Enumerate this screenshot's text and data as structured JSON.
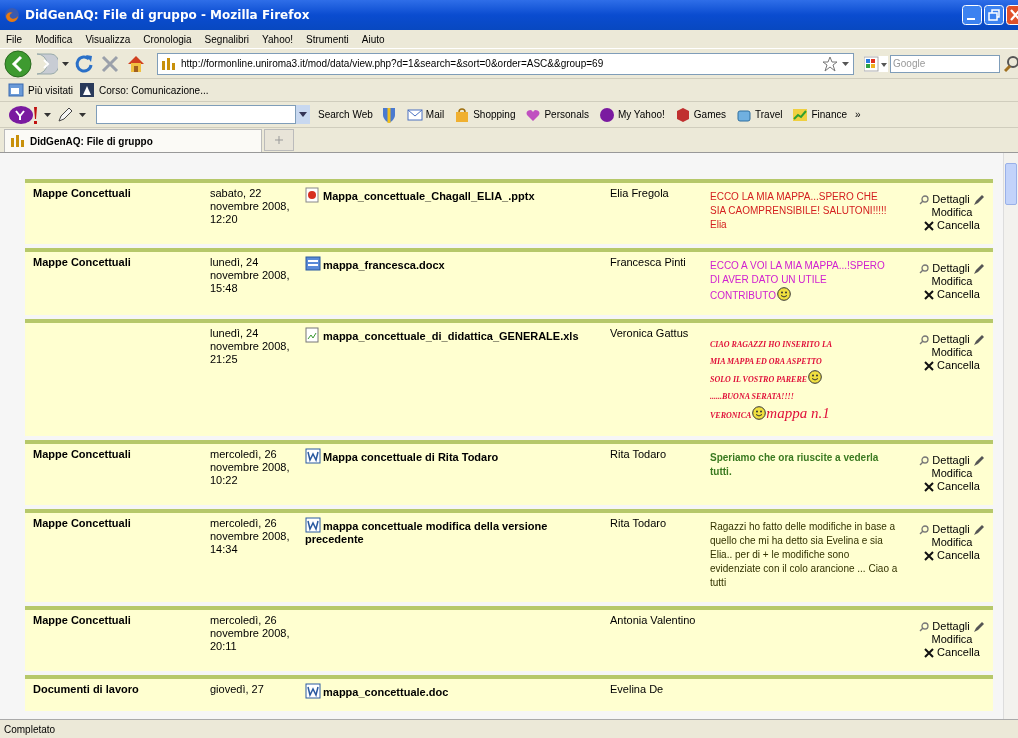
{
  "window": {
    "title": "DidGenAQ: File di gruppo - Mozilla Firefox"
  },
  "menu": [
    "File",
    "Modifica",
    "Visualizza",
    "Cronologia",
    "Segnalibri",
    "Yahoo!",
    "Strumenti",
    "Aiuto"
  ],
  "address": {
    "url": "http://formonline.uniroma3.it/mod/data/view.php?d=1&search=&sort=0&order=ASC&&group=69"
  },
  "web_search": {
    "placeholder": "Google"
  },
  "bookmarks": [
    "Più visitati",
    "Corso: Comunicazione..."
  ],
  "yahoo_toolbar": {
    "search_button": "Search Web",
    "items": [
      "Mail",
      "Shopping",
      "Personals",
      "My Yahoo!",
      "Games",
      "Travel",
      "Finance"
    ],
    "more": "»"
  },
  "tabs": [
    {
      "label": "DidGenAQ: File di gruppo",
      "selected": true
    }
  ],
  "entries": [
    {
      "category": "Mappe Concettuali",
      "date": "sabato, 22 novembre 2008, 12:20",
      "file": {
        "kind": "presentation",
        "name": "Mappa_concettuale_Chagall_ELIA_.pptx"
      },
      "author": "Elia Fregola",
      "comment": {
        "kind": "plain",
        "color": "#d42020",
        "lines": [
          [
            {
              "kind": "text",
              "text": "ECCO LA MIA MAPPA...SPERO CHE SIA CAOMPRENSIBILE! SALUTONI!!!!! Elia"
            }
          ]
        ]
      },
      "actions": {
        "details": "Dettagli",
        "edit": "Modifica",
        "delete": "Cancella"
      }
    },
    {
      "category": "Mappe Concettuali",
      "date": "lunedì, 24 novembre 2008, 15:48",
      "file": {
        "kind": "document",
        "name": "mappa_francesca.docx"
      },
      "author": "Francesca Pinti",
      "comment": {
        "kind": "plain",
        "color": "#d020d0",
        "lines": [
          [
            {
              "kind": "text",
              "text": "ECCO A VOI LA MIA MAPPA...!SPERO DI AVER DATO UN UTILE"
            }
          ],
          [
            {
              "kind": "text",
              "text": "CONTRIBUTO"
            },
            {
              "kind": "smiley"
            }
          ]
        ]
      },
      "actions": {
        "details": "Dettagli",
        "edit": "Modifica",
        "delete": "Cancella"
      }
    },
    {
      "date": "lunedì, 24 novembre 2008, 21:25",
      "file": {
        "kind": "broken",
        "name": "mappa_concettuale_di_didattica_GENERALE.xls"
      },
      "author": "Veronica Gattus",
      "comment": {
        "kind": "fancy",
        "color": "#e0103a",
        "lines": [
          [
            {
              "kind": "text",
              "text": "CIAO RAGAZZI HO INSERITO LA"
            }
          ],
          [
            {
              "kind": "text",
              "text": "MIA MAPPA ED ORA ASPETTO"
            }
          ],
          [
            {
              "kind": "text",
              "text": "SOLO IL VOSTRO PARERE"
            },
            {
              "kind": "smiley"
            }
          ],
          [
            {
              "kind": "text",
              "text": "......BUONA SERATA!!!!"
            }
          ],
          [
            {
              "kind": "text",
              "text": "VERONICA"
            },
            {
              "kind": "smiley"
            },
            {
              "kind": "large",
              "text": "mappa n.1"
            }
          ]
        ]
      },
      "actions": {
        "details": "Dettagli",
        "edit": "Modifica",
        "delete": "Cancella"
      }
    },
    {
      "category": "Mappe Concettuali",
      "date": "mercoledì, 26 novembre 2008, 10:22",
      "file": {
        "kind": "word",
        "name": "Mappa concettuale di Rita Todaro"
      },
      "author": "Rita Todaro",
      "comment": {
        "kind": "bold",
        "color": "#3a7a20",
        "lines": [
          [
            {
              "kind": "text",
              "text": "Speriamo che ora riuscite a vederla tutti."
            }
          ]
        ]
      },
      "actions": {
        "details": "Dettagli",
        "edit": "Modifica",
        "delete": "Cancella"
      }
    },
    {
      "category": "Mappe Concettuali",
      "date": "mercoledì, 26 novembre 2008, 14:34",
      "file": {
        "kind": "word",
        "name": "mappa concettuale modifica della versione precedente"
      },
      "author": "Rita Todaro",
      "comment": {
        "kind": "small",
        "color": "#333300",
        "lines": [
          [
            {
              "kind": "text",
              "text": "Ragazzi ho fatto delle modifiche in base a quello che mi ha detto sia Evelina e sia Elia..  per di + le modifiche  sono evidenziate con il colo arancione ... Ciao a tutti"
            }
          ]
        ]
      },
      "actions": {
        "details": "Dettagli",
        "edit": "Modifica",
        "delete": "Cancella"
      }
    },
    {
      "category": "Mappe Concettuali",
      "date": "mercoledì, 26 novembre 2008, 20:11",
      "author": "Antonia Valentino",
      "actions": {
        "details": "Dettagli",
        "edit": "Modifica",
        "delete": "Cancella"
      }
    },
    {
      "category": "Documenti di lavoro",
      "date": "giovedì, 27",
      "file": {
        "kind": "word",
        "name": "mappa_concettuale.doc"
      },
      "author": "Evelina De"
    }
  ],
  "status_bar": "Completato"
}
